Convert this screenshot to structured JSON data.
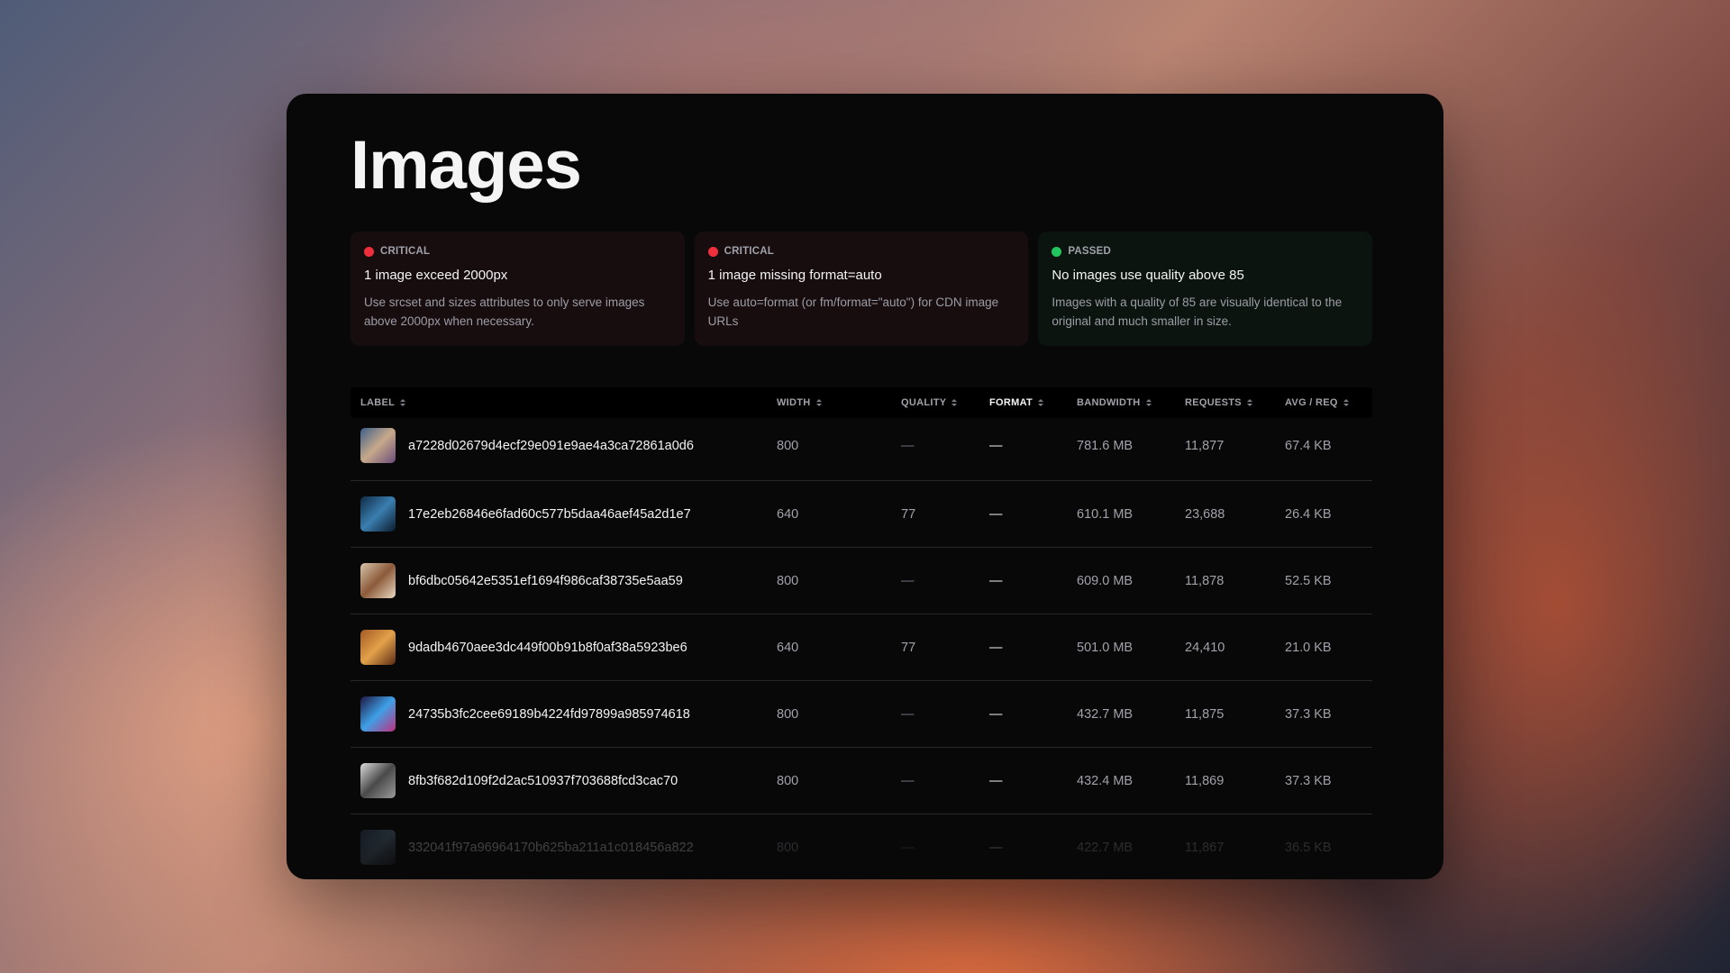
{
  "page": {
    "title": "Images"
  },
  "cards": [
    {
      "status": "CRITICAL",
      "status_color": "#ef2f3c",
      "title": "1 image exceed 2000px",
      "description": "Use srcset and sizes attributes to only serve images above 2000px when necessary."
    },
    {
      "status": "CRITICAL",
      "status_color": "#ef2f3c",
      "title": "1 image missing format=auto",
      "description": "Use auto=format (or fm/format=\"auto\") for CDN image URLs"
    },
    {
      "status": "PASSED",
      "status_color": "#22c55e",
      "title": "No images use quality above 85",
      "description": "Images with a quality of 85 are visually identical to the original and much smaller in size."
    }
  ],
  "table": {
    "columns": {
      "label": "LABEL",
      "width": "WIDTH",
      "quality": "QUALITY",
      "format": "FORMAT",
      "bandwidth": "BANDWIDTH",
      "requests": "REQUESTS",
      "avg_req": "AVG / REQ"
    },
    "active_column": "format",
    "rows": [
      {
        "label": "a7228d02679d4ecf29e091e9ae4a3ca72861a0d6",
        "width": "800",
        "quality": "—",
        "format": "—",
        "bandwidth": "781.6 MB",
        "requests": "11,877",
        "avg_req": "67.4 KB",
        "thumb_colors": [
          "#3d5f8a",
          "#c7a98a",
          "#6a4c7a"
        ]
      },
      {
        "label": "17e2eb26846e6fad60c577b5daa46aef45a2d1e7",
        "width": "640",
        "quality": "77",
        "format": "—",
        "bandwidth": "610.1 MB",
        "requests": "23,688",
        "avg_req": "26.4 KB",
        "thumb_colors": [
          "#0f2a44",
          "#3a7fb0",
          "#0b1a2c"
        ]
      },
      {
        "label": "bf6dbc05642e5351ef1694f986caf38735e5aa59",
        "width": "800",
        "quality": "—",
        "format": "—",
        "bandwidth": "609.0 MB",
        "requests": "11,878",
        "avg_req": "52.5 KB",
        "thumb_colors": [
          "#d7c4aa",
          "#8c5a3a",
          "#e9d9c2"
        ]
      },
      {
        "label": "9dadb4670aee3dc449f00b91b8f0af38a5923be6",
        "width": "640",
        "quality": "77",
        "format": "—",
        "bandwidth": "501.0 MB",
        "requests": "24,410",
        "avg_req": "21.0 KB",
        "thumb_colors": [
          "#a45a24",
          "#e3a14a",
          "#5a2a14"
        ]
      },
      {
        "label": "24735b3fc2cee69189b4224fd97899a985974618",
        "width": "800",
        "quality": "—",
        "format": "—",
        "bandwidth": "432.7 MB",
        "requests": "11,875",
        "avg_req": "37.3 KB",
        "thumb_colors": [
          "#1d1640",
          "#3fa0e6",
          "#c03080"
        ]
      },
      {
        "label": "8fb3f682d109f2d2ac510937f703688fcd3cac70",
        "width": "800",
        "quality": "—",
        "format": "—",
        "bandwidth": "432.4 MB",
        "requests": "11,869",
        "avg_req": "37.3 KB",
        "thumb_colors": [
          "#dcdcdc",
          "#4a4a4a",
          "#9a9a9a"
        ]
      },
      {
        "label": "332041f97a96964170b625ba211a1c018456a822",
        "width": "800",
        "quality": "—",
        "format": "—",
        "bandwidth": "422.7 MB",
        "requests": "11,867",
        "avg_req": "36.5 KB",
        "thumb_colors": [
          "#3a4a6a",
          "#6a8aa0",
          "#2a2a3a"
        ]
      }
    ]
  }
}
